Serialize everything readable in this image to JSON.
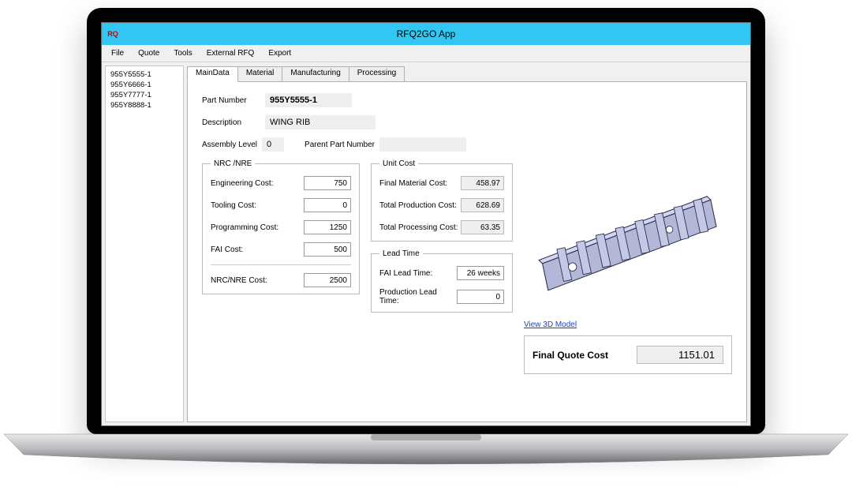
{
  "title": "RFQ2GO App",
  "menus": [
    "File",
    "Quote",
    "Tools",
    "External RFQ",
    "Export"
  ],
  "sidebar": {
    "items": [
      "955Y5555-1",
      "955Y6666-1",
      "955Y7777-1",
      "955Y8888-1"
    ]
  },
  "tabs": [
    "MainData",
    "Material",
    "Manufacturing",
    "Processing"
  ],
  "form": {
    "part_number_label": "Part Number",
    "part_number": "955Y5555-1",
    "description_label": "Description",
    "description": "WING RIB",
    "assembly_level_label": "Assembly Level",
    "assembly_level": "0",
    "parent_pn_label": "Parent Part Number",
    "parent_pn": ""
  },
  "nrc": {
    "legend": "NRC /NRE",
    "eng_label": "Engineering Cost:",
    "eng": "750",
    "tool_label": "Tooling Cost:",
    "tool": "0",
    "prog_label": "Programming Cost:",
    "prog": "1250",
    "fai_label": "FAI Cost:",
    "fai": "500",
    "total_label": "NRC/NRE Cost:",
    "total": "2500"
  },
  "unit": {
    "legend": "Unit Cost",
    "mat_label": "Final Material Cost:",
    "mat": "458.97",
    "prod_label": "Total Production Cost:",
    "prod": "628.69",
    "proc_label": "Total Processing Cost:",
    "proc": "63.35"
  },
  "lead": {
    "legend": "Lead Time",
    "fai_label": "FAI Lead Time:",
    "fai": "26 weeks",
    "prod_label": "Production Lead Time:",
    "prod": "0"
  },
  "preview": {
    "link": "View 3D Model"
  },
  "final": {
    "label": "Final Quote Cost",
    "value": "1151.01"
  }
}
